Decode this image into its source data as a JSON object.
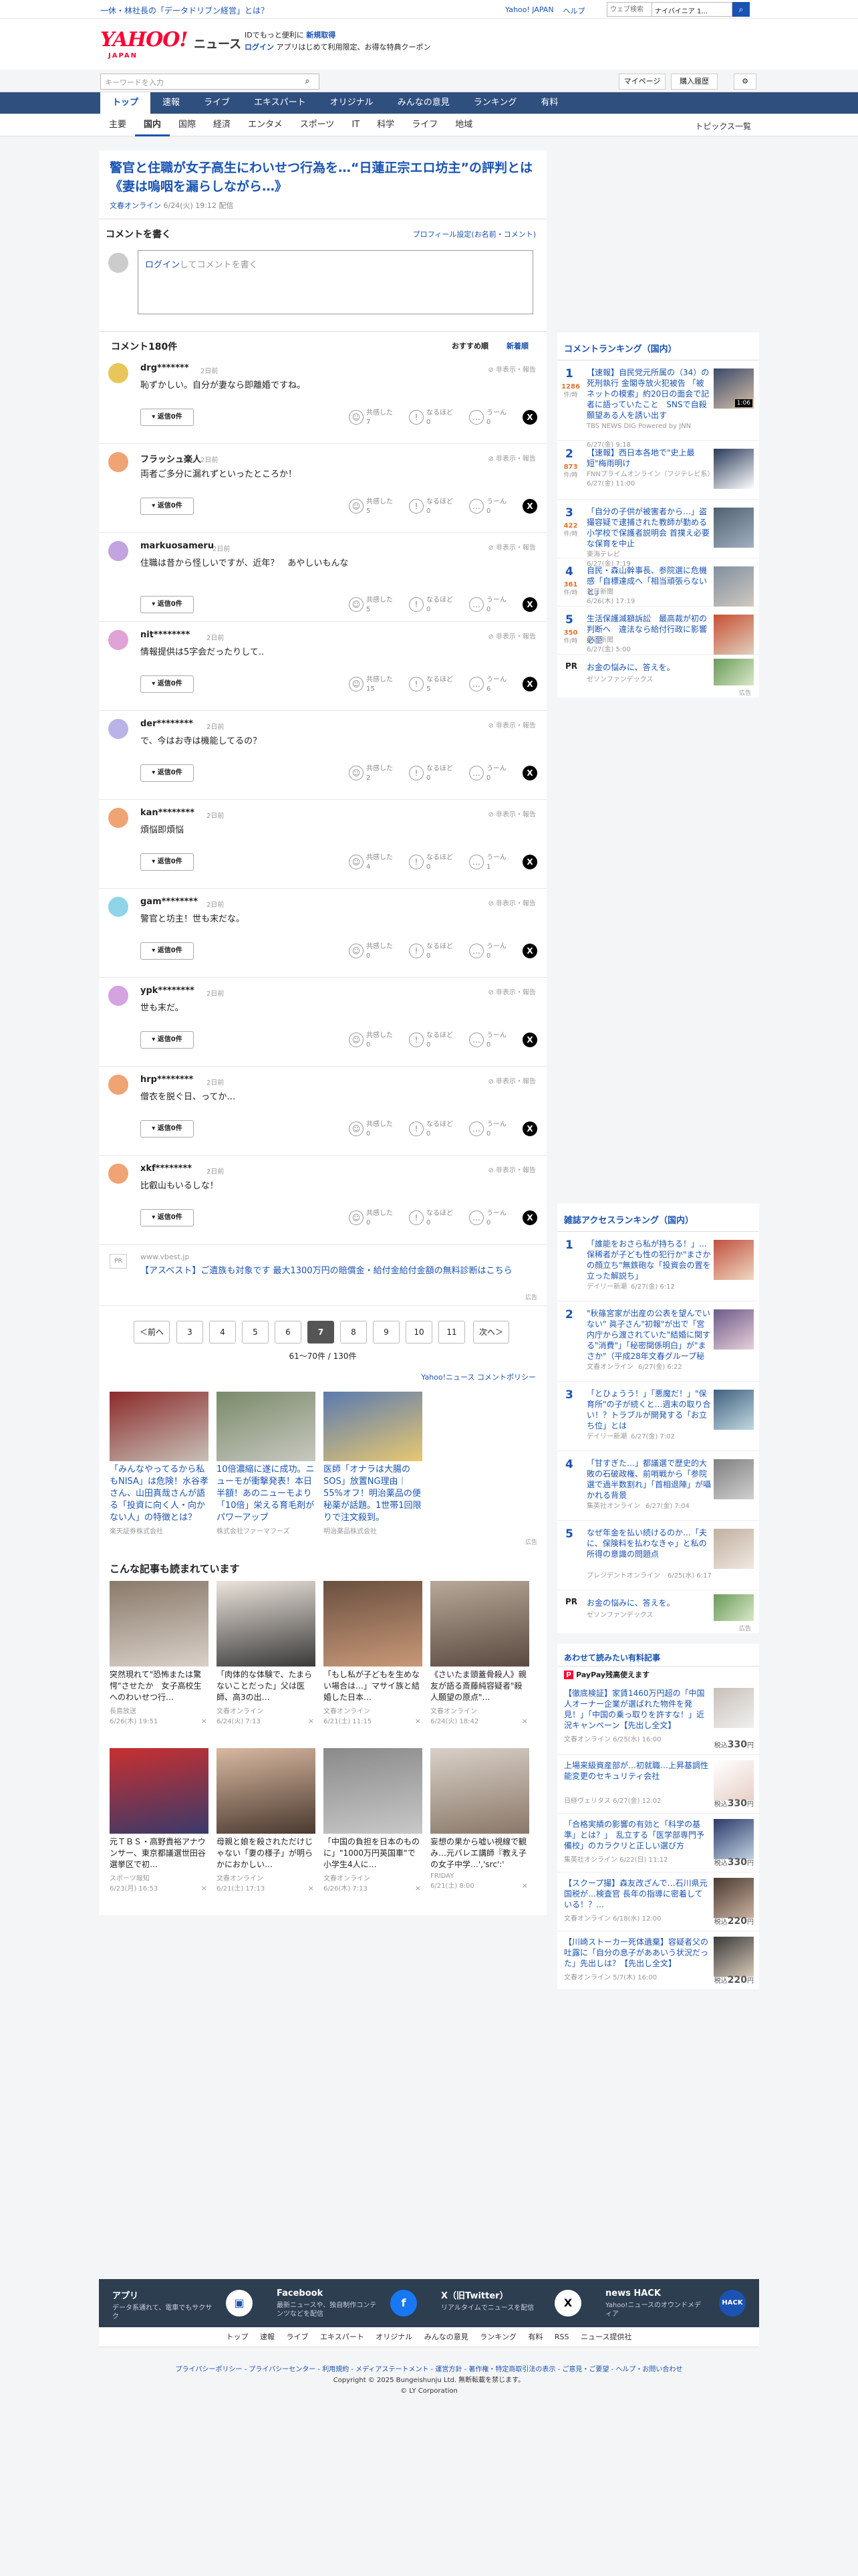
{
  "topbar": {
    "promo": "一休・林社長の「データドリブン経営」とは？",
    "links": [
      "Yahoo! JAPAN",
      "ヘルプ"
    ],
    "search_placeholder": "ウェブ検索",
    "search_value": "ナイバイニア 1...",
    "search_icon": "search-icon"
  },
  "header": {
    "logo": "YAHOO!",
    "logo_sub": "JAPAN",
    "section": "ニュース",
    "line1a": "IDでもっと便利に",
    "line1b": "新規取得",
    "line2a": "ログイン",
    "line2b": "アプリはじめて利用限定、お得な特典クーポン"
  },
  "searchrow": {
    "placeholder": "キーワードを入力",
    "mypage": "マイページ",
    "purchase": "購入履歴",
    "gear": "gear-icon"
  },
  "nav1": [
    "トップ",
    "速報",
    "ライブ",
    "エキスパート",
    "オリジナル",
    "みんなの意見",
    "ランキング",
    "有料"
  ],
  "nav2": [
    "主要",
    "国内",
    "国際",
    "経済",
    "エンタメ",
    "スポーツ",
    "IT",
    "科学",
    "ライフ",
    "地域"
  ],
  "nav2_right": "トピックス一覧",
  "article": {
    "title": "警官と住職が女子高生にわいせつ行為を…“日蓮正宗エロ坊主”の評判とは《妻は嗚咽を漏らしながら…》",
    "source": "文春オンライン",
    "date": "6/24(火) 19:12 配信"
  },
  "comment_write": {
    "title": "コメントを書く",
    "profile": "プロフィール設定(お名前・コメント)",
    "login": "ログイン",
    "placeholder": "してコメントを書く"
  },
  "comments_head": {
    "title": "コメント180件",
    "sort1": "おすすめ順",
    "sort2": "新着順"
  },
  "comment_labels": {
    "report": "非表示・報告",
    "reply": "返信0件",
    "agree": "共感した",
    "insight": "なるほど",
    "hmm": "うーん"
  },
  "comments": [
    {
      "user": "drg*******",
      "ago": "2日前",
      "text": "恥ずかしい。自分が妻なら即離婚ですね。",
      "agree": "7",
      "insight": "0",
      "hmm": "0",
      "color": "#e8c65a"
    },
    {
      "user": "フラッシュ楽人",
      "ago": "2日前",
      "text": "両者ご多分に漏れずといったところか！",
      "agree": "5",
      "insight": "0",
      "hmm": "0",
      "color": "#f0a373"
    },
    {
      "user": "markuosameru",
      "ago": "2日前",
      "text": "住職は昔から怪しいですが、近年？　あやしいもんな",
      "agree": "5",
      "insight": "0",
      "hmm": "0",
      "color": "#c3a3e0"
    },
    {
      "user": "nit********",
      "ago": "2日前",
      "text": "情報提供は5字会だったりして..",
      "agree": "15",
      "insight": "5",
      "hmm": "6",
      "color": "#e0a3d6"
    },
    {
      "user": "der********",
      "ago": "2日前",
      "text": "で、今はお寺は機能してるの？",
      "agree": "2",
      "insight": "0",
      "hmm": "0",
      "color": "#b9b3e8"
    },
    {
      "user": "kan********",
      "ago": "2日前",
      "text": "煩悩即煩悩",
      "agree": "4",
      "insight": "0",
      "hmm": "1",
      "color": "#f0a373"
    },
    {
      "user": "gam********",
      "ago": "2日前",
      "text": "警官と坊主！世も末だな。",
      "agree": "0",
      "insight": "0",
      "hmm": "0",
      "color": "#8fd4e8"
    },
    {
      "user": "ypk********",
      "ago": "2日前",
      "text": "世も末だ。",
      "agree": "0",
      "insight": "0",
      "hmm": "0",
      "color": "#d4a3e0"
    },
    {
      "user": "hrp********",
      "ago": "2日前",
      "text": "僧衣を脱ぐ日、ってか…",
      "agree": "0",
      "insight": "0",
      "hmm": "0",
      "color": "#f0a373"
    },
    {
      "user": "xkf********",
      "ago": "2日前",
      "text": "比叡山もいるしな！",
      "agree": "0",
      "insight": "0",
      "hmm": "0",
      "color": "#f0a373"
    }
  ],
  "ad_text": {
    "pr": "PR",
    "domain": "www.vbest.jp",
    "text": "【アスベスト】ご遺族も対象です 最大1300万円の賠償金・給付金給付金額の無料診断はこちら",
    "mark": "広告"
  },
  "pager": {
    "prev": "＜前へ",
    "pages": [
      "3",
      "4",
      "5",
      "6",
      "7",
      "8",
      "9",
      "10",
      "11"
    ],
    "current": "7",
    "next": "次へ＞",
    "count": "61〜70件 / 130件"
  },
  "policy": "Yahoo!ニュース コメントポリシー",
  "ad_cards": [
    {
      "title": "「みんなやってるから私もNISA」は危険！水谷孝さん、山田真哉さんが語る「投資に向く人・向かない人」の特徴とは？",
      "sponsor": "楽天証券株式会社",
      "c1": "#8b2a2a",
      "c2": "#c8c0b8"
    },
    {
      "title": "10倍濃縮に遂に成功。ニューモが衝撃発表！本日半額！あのニューモより「10倍」栄える育毛剤がパワーアップ",
      "sponsor": "株式会社ファーマフーズ",
      "c1": "#7a8a6a",
      "c2": "#c8c8c0"
    },
    {
      "title": "医師「オナラは大腸のSOS」放置NG理由｜55%オフ！明治薬品の便秘薬が話題。1世帯1回限りで注文殺到。",
      "sponsor": "明治薬品株式会社",
      "c1": "#5a7ab0",
      "c2": "#e8c870"
    }
  ],
  "admark": "広告",
  "recommend": {
    "title": "こんな記事も読まれています",
    "items": [
      {
        "title": "突然現れて\"恐怖または驚愕\"させたか　女子高校生へのわいせつ行…",
        "src": "長島放送",
        "date": "6/26(木) 19:51",
        "c1": "#8a7a6a",
        "c2": "#d8d0c8"
      },
      {
        "title": "「肉体的な体験で、たまらないことだった」父は医師、高3の出…",
        "src": "文春オンライン",
        "date": "6/24(火) 7:13",
        "c1": "#ece4dc",
        "c2": "#3a3a3a"
      },
      {
        "title": "「もし私が子どもを生めない場合は…」マサイ族と結婚した日本…",
        "src": "文春オンライン",
        "date": "6/21(土) 11:15",
        "c1": "#6a5040",
        "c2": "#c89878"
      },
      {
        "title": "《さいたま頭蓋骨殺人》親友が語る斎藤純容疑者\"殺人願望の原点\"…",
        "src": "文春オンライン",
        "date": "6/24(火) 18:42",
        "c1": "#b8a898",
        "c2": "#5a4a40"
      },
      {
        "title": "元ＴＢＳ・高野貴裕アナウンサー、東京都議選世田谷選挙区で初…",
        "src": "スポーツ報知",
        "date": "6/23(月) 16:53",
        "c1": "#c83030",
        "c2": "#3a3a6a"
      },
      {
        "title": "母親と娘を殺されただけじゃない「妻の様子」が明らかにおかしい…",
        "src": "文春オンライン",
        "date": "6/21(土) 17:13",
        "c1": "#d8b8a0",
        "c2": "#4a3a30"
      },
      {
        "title": "「中国の負担を日本のものに」\"1000万円英国車\"で小学生4人に…",
        "src": "文春オンライン",
        "date": "6/26(木) 7:13",
        "c1": "#8a8a8a",
        "c2": "#c8c8c8"
      },
      {
        "title": "妄想の果から嘘い視線で観み…元バレエ講師『教え子の女子中学…','src':'",
        "src": "FRIDAY",
        "date": "6/21(土) 8:00",
        "c1": "#d8d0c8",
        "c2": "#8a7868"
      }
    ]
  },
  "ranking": {
    "title": "コメントランキング（国内）",
    "items": [
      {
        "n": "1",
        "count": "1286",
        "unit": "件/時",
        "title": "【速報】自民党元所属の（34）の死刑執行 金閣寺放火犯被告 「被ネットの模索」約20日の面会で記者に語っていたこと　SNSで自殺願望ある人を誘い出す",
        "meta": "TBS NEWS DIG Powered by JNN",
        "date": "6/27(金) 9:18",
        "c1": "#3a4a6a",
        "c2": "#d8c0a8",
        "dur": "1:06"
      },
      {
        "n": "2",
        "count": "873",
        "unit": "件/時",
        "title": "【速報】西日本各地で\"史上最短\"梅雨明け",
        "meta": "FNNプライムオンライン（フジテレビ系）",
        "date": "6/27(金) 11:00",
        "c1": "#2a3a5a",
        "c2": "#ffffff"
      },
      {
        "n": "3",
        "count": "422",
        "unit": "件/時",
        "title": "「自分の子供が被害者から…」盗撮容疑で逮捕された教師が勤める小学校で保護者説明会 首撲え必要な保育を中止",
        "meta": "東海テレビ",
        "date": "6/27(金) 7:19",
        "c1": "#506070",
        "c2": "#a0b0c0"
      },
      {
        "n": "4",
        "count": "361",
        "unit": "件/時",
        "title": "自民・森山幹事長、参院選に危機感「自標達成へ「相当頑張らないと」",
        "meta": "毎日新聞",
        "date": "6/26(木) 17:19",
        "c1": "#8090a0",
        "c2": "#d0c8c0"
      },
      {
        "n": "5",
        "count": "350",
        "unit": "件/時",
        "title": "生活保護減額訴訟　最高裁が初の判断へ　違法なら給付行政に影響必至",
        "meta": "朝日新聞",
        "date": "6/27(金) 5:00",
        "c1": "#c85030",
        "c2": "#e0d0c0"
      }
    ],
    "pr_title": "お金の悩みに、答えを。",
    "pr_sponsor": "ゼソンファンデックス",
    "pr_label": "PR",
    "admark": "広告"
  },
  "ranking2": {
    "title": "雑誌アクセスランキング（国内）",
    "items": [
      {
        "n": "1",
        "title": "「誰能をおさら私が持ちる！」…保稀者が子ども性の犯行か\"まさかの顔立ち\"無鉄砲な「投資会の置を立った解説ち」",
        "meta": "デイリー新潮",
        "date": "6/27(金) 6:12",
        "c1": "#c05040",
        "c2": "#f0d8c0"
      },
      {
        "n": "2",
        "title": "\"秋篠宮家が出産の公表を望んでいない\" 眞子さん\"初報\"が出で「宮内庁から渡されていた\"結婚に関する\"消費\"」「秘密関係明白」が\"まさか\"（平成28年文春グループ秘密への事前反対記）",
        "meta": "文春オンライン",
        "date": "6/27(金) 6:22",
        "c1": "#6a5a8a",
        "c2": "#e8d0d8"
      },
      {
        "n": "3",
        "title": "「とひょうう！」「悪魔だ！」\"保育所\"の子が続くと…週末の取り合い！？トラブルが開発する「お立ち位」とは",
        "meta": "デイリー新潮",
        "date": "6/27(金) 7:02",
        "c1": "#406080",
        "c2": "#c0d8e0"
      },
      {
        "n": "4",
        "title": "「甘すぎた…」都議選で歴史的大敗の石破政権、前哨戦から「参院選で過半数割れ」「首相退陣」が囁かれる背景",
        "meta": "集英社オンライン",
        "date": "6/27(金) 7:04",
        "c1": "#808080",
        "c2": "#d0d0d0"
      },
      {
        "n": "5",
        "title": "なぜ年金を払い続けるのか…「夫に、保険料を払わなきゃ」と私の所得の意識の問題点",
        "meta": "プレジデントオンライン",
        "date": "6/25(水) 6:17",
        "c1": "#c0b0a0",
        "c2": "#f0e8e0"
      }
    ],
    "pr_title": "お金の悩みに、答えを。",
    "pr_sponsor": "ゼソンファンデックス",
    "pr_label": "PR",
    "admark": "広告"
  },
  "ec": {
    "title": "あわせて読みたい有料記事",
    "paypay": "PayPay残高使えます",
    "items": [
      {
        "title": "【徹底検証】家賃1460万円超の「中国人オーナー企業が選ばれた物件を発見！」「中国の乗っ取りを許すな！」近況キャンペーン【先出し全文】",
        "meta": "文春オンライン 6/25(水) 16:00",
        "price": "330",
        "c1": "#c8c0b8",
        "c2": "#f0f0f0"
      },
      {
        "title": "上場来級資産部が…初就職…上昇基調性能変更のセキュリティ会社",
        "meta": "日経ヴェリタス 6/27(金) 12:02",
        "price": "330",
        "c1": "#ffffff",
        "c2": "#e8d0c8"
      },
      {
        "title": "「合格実績の影響の有効と「科学の基準」とは？」　乱立する「医学部専門予備校」のカラクリと正しい選び方",
        "meta": "集英社オンライン 6/22(日) 11:12",
        "price": "330",
        "c1": "#2a3a6a",
        "c2": "#c0d0e0"
      },
      {
        "title": "【スクープ撮】森友改ざんで…石川県元国税が…検査官 長年の指導に密着している！？…",
        "meta": "文春オンライン 6/18(水) 12:00",
        "price": "220",
        "c1": "#4a3a30",
        "c2": "#c8b0a0"
      },
      {
        "title": "【川崎ストーカー死体遺棄】容疑者父の吐露に「自分の息子がああいう状況だった」先出しは？【先出し全文】",
        "meta": "文春オンライン 5/7(木) 16:00",
        "price": "220",
        "c1": "#3a3a3a",
        "c2": "#d8c8b8"
      }
    ],
    "tax": "税込"
  },
  "footer": {
    "cols": [
      {
        "title": "アプリ",
        "desc": "データ系通れて、電車でもサクサク",
        "icon": "app-icon",
        "glyph": "▣"
      },
      {
        "title": "Facebook",
        "desc": "最新ニュースや、独自制作コンテンツなどを配信",
        "icon": "facebook-icon",
        "glyph": "f"
      },
      {
        "title": "X（旧Twitter）",
        "desc": "リアルタイムでニュースを配信",
        "icon": "x-icon",
        "glyph": "X"
      },
      {
        "title": "news HACK",
        "desc": "Yahoo!ニュースのオウンドメディア",
        "icon": "newshack-icon",
        "glyph": "HACK"
      }
    ],
    "links": [
      "トップ",
      "速報",
      "ライブ",
      "エキスパート",
      "オリジナル",
      "みんなの意見",
      "ランキング",
      "有料",
      "RSS",
      "ニュース提供社"
    ],
    "legal": "プライバシーポリシー - プライバシーセンター - 利用規約 - メディアステートメント - 運営方針 - 著作権・特定商取引法の表示 - ご意見・ご要望 - ヘルプ・お問い合わせ",
    "copyright": "Copyright © 2025 Bungeishunju Ltd. 無断転載を禁じます。",
    "corp": "© LY Corporation"
  }
}
